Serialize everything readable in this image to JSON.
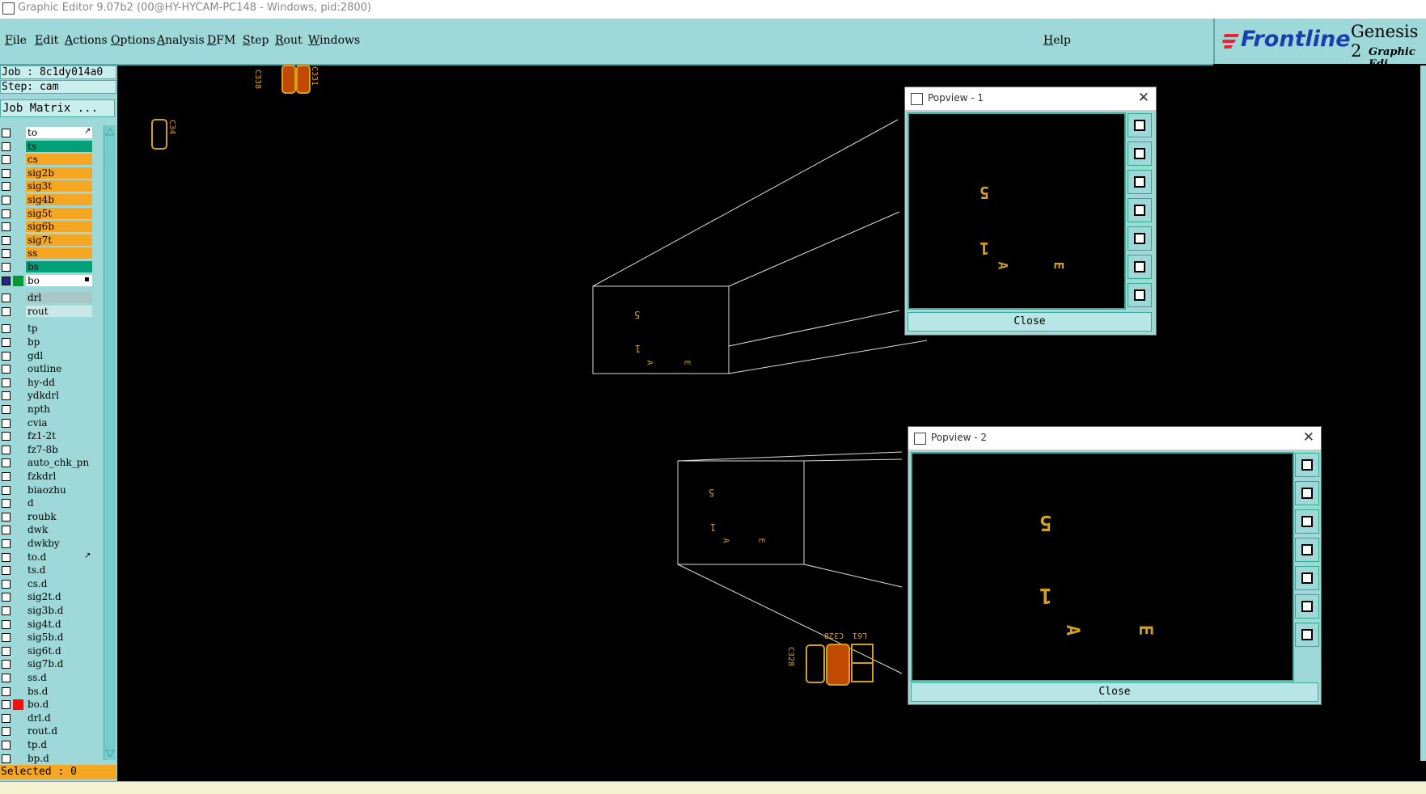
{
  "window": {
    "title": "Graphic Editor 9.07b2 (00@HY-HYCAM-PC148 - Windows, pid:2800)"
  },
  "menu": [
    "File",
    "Edit",
    "Actions",
    "Options",
    "Analysis",
    "DFM",
    "Step",
    "Rout",
    "Windows"
  ],
  "help_label": "Help",
  "brand": {
    "logo": "Frontline",
    "product": "Genesis 2",
    "sub": "Graphic Edi"
  },
  "job": {
    "job_line": "Job : 8c1dy014a0",
    "step_line": "Step: cam",
    "matrix_button": "Job Matrix ..."
  },
  "layers": [
    {
      "name": "to",
      "bg": "#ffffff",
      "mark": "↗"
    },
    {
      "name": "ts",
      "bg": "#00a078"
    },
    {
      "name": "cs",
      "bg": "#f5a623"
    },
    {
      "name": "sig2b",
      "bg": "#f5a623"
    },
    {
      "name": "sig3t",
      "bg": "#f5a623"
    },
    {
      "name": "sig4b",
      "bg": "#f5a623"
    },
    {
      "name": "sig5t",
      "bg": "#f5a623"
    },
    {
      "name": "sig6b",
      "bg": "#f5a623"
    },
    {
      "name": "sig7t",
      "bg": "#f5a623"
    },
    {
      "name": "ss",
      "bg": "#f5a623"
    },
    {
      "name": "bs",
      "bg": "#00a078"
    },
    {
      "name": "bo",
      "bg": "#ffffff",
      "color": "#009933",
      "chk": "#1a2a9a",
      "mark": "▪"
    },
    {
      "name": "drl",
      "bg": "#a8c8c8",
      "gap": true
    },
    {
      "name": "rout",
      "bg": "#c9e8e8"
    },
    {
      "name": "tp",
      "bg": "#9fd8d8",
      "gap": true
    },
    {
      "name": "bp",
      "bg": "#9fd8d8"
    },
    {
      "name": "gdl",
      "bg": "#9fd8d8"
    },
    {
      "name": "outline",
      "bg": "#9fd8d8"
    },
    {
      "name": "hy-dd",
      "bg": "#9fd8d8"
    },
    {
      "name": "ydkdrl",
      "bg": "#9fd8d8"
    },
    {
      "name": "npth",
      "bg": "#9fd8d8"
    },
    {
      "name": "cvia",
      "bg": "#9fd8d8"
    },
    {
      "name": "fz1-2t",
      "bg": "#9fd8d8"
    },
    {
      "name": "fz7-8b",
      "bg": "#9fd8d8"
    },
    {
      "name": "auto_chk_pn",
      "bg": "#9fd8d8"
    },
    {
      "name": "fzkdrl",
      "bg": "#9fd8d8"
    },
    {
      "name": "biaozhu",
      "bg": "#9fd8d8"
    },
    {
      "name": "d",
      "bg": "#9fd8d8"
    },
    {
      "name": "roubk",
      "bg": "#9fd8d8"
    },
    {
      "name": "dwk",
      "bg": "#9fd8d8"
    },
    {
      "name": "dwkby",
      "bg": "#9fd8d8"
    },
    {
      "name": "to.d",
      "bg": "#9fd8d8",
      "mark": "↗"
    },
    {
      "name": "ts.d",
      "bg": "#9fd8d8"
    },
    {
      "name": "cs.d",
      "bg": "#9fd8d8"
    },
    {
      "name": "sig2t.d",
      "bg": "#9fd8d8"
    },
    {
      "name": "sig3b.d",
      "bg": "#9fd8d8"
    },
    {
      "name": "sig4t.d",
      "bg": "#9fd8d8"
    },
    {
      "name": "sig5b.d",
      "bg": "#9fd8d8"
    },
    {
      "name": "sig6t.d",
      "bg": "#9fd8d8"
    },
    {
      "name": "sig7b.d",
      "bg": "#9fd8d8"
    },
    {
      "name": "ss.d",
      "bg": "#9fd8d8"
    },
    {
      "name": "bs.d",
      "bg": "#9fd8d8"
    },
    {
      "name": "bo.d",
      "bg": "#9fd8d8",
      "color": "#ee1111"
    },
    {
      "name": "drl.d",
      "bg": "#9fd8d8"
    },
    {
      "name": "rout.d",
      "bg": "#9fd8d8"
    },
    {
      "name": "tp.d",
      "bg": "#9fd8d8"
    },
    {
      "name": "bp.d",
      "bg": "#9fd8d8"
    },
    {
      "name": "gdl.d",
      "bg": "#9fd8d8"
    }
  ],
  "selected_label": "Selected : 0",
  "popview1": {
    "title": "Popview - 1",
    "close_label": "Close"
  },
  "popview2": {
    "title": "Popview - 2",
    "close_label": "Close"
  },
  "glyphs": {
    "five": "5",
    "one": "1",
    "a": "A",
    "e": "E"
  },
  "components": {
    "c338": "C338",
    "c331": "C331",
    "c34": "C34",
    "c328": "C328",
    "c328b": "C328",
    "l61": "L61"
  },
  "colors": {
    "accent_panel": "#9fd8d8",
    "pad_outline": "#d4a017",
    "pad_fill": "#c24a00",
    "canvas": "#000000"
  },
  "popview_tool_icons": [
    "zoom-fit-icon",
    "pan-up-icon",
    "pan-down-icon",
    "pan-left-icon",
    "pan-right-icon",
    "zoom-in-icon",
    "zoom-out-icon"
  ]
}
